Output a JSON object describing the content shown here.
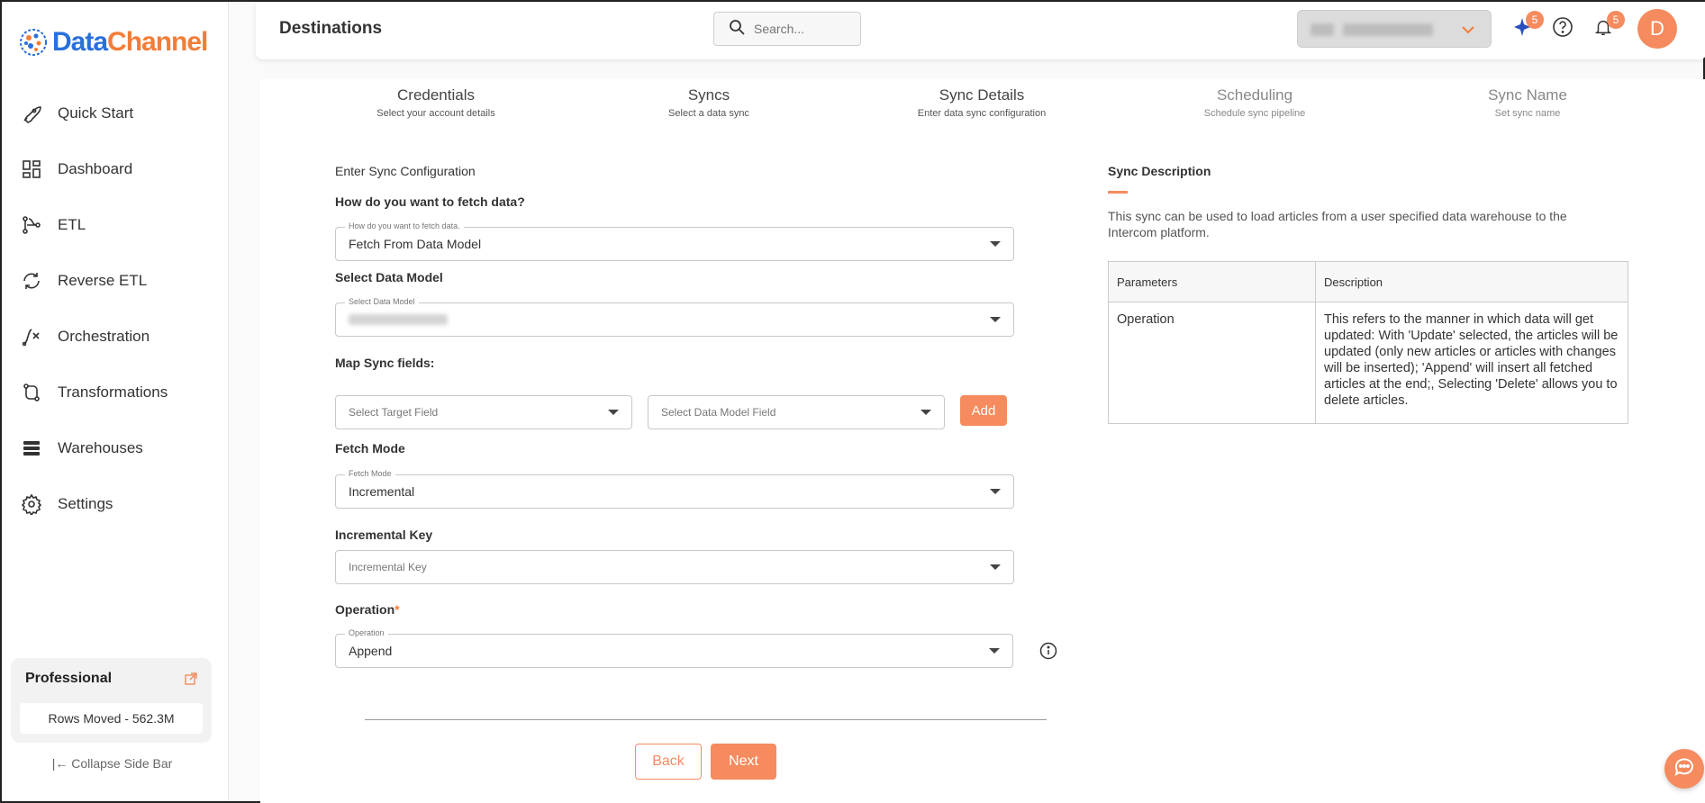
{
  "brand": {
    "name_part1": "Data",
    "name_part2": "Channel",
    "accent": "#f58b5e",
    "blue": "#2a6fdb"
  },
  "sidebar": {
    "items": [
      {
        "label": "Quick Start",
        "icon": "rocket-icon"
      },
      {
        "label": "Dashboard",
        "icon": "dashboard-icon"
      },
      {
        "label": "ETL",
        "icon": "etl-icon"
      },
      {
        "label": "Reverse ETL",
        "icon": "reverse-etl-icon"
      },
      {
        "label": "Orchestration",
        "icon": "orchestration-icon"
      },
      {
        "label": "Transformations",
        "icon": "transformations-icon"
      },
      {
        "label": "Warehouses",
        "icon": "warehouses-icon"
      },
      {
        "label": "Settings",
        "icon": "gear-icon"
      }
    ],
    "plan": {
      "title": "Professional",
      "rows_moved": "Rows Moved - 562.3M"
    },
    "collapse_label": "Collapse Side Bar"
  },
  "header": {
    "title": "Destinations",
    "search_placeholder": "Search...",
    "ai_badge": "5",
    "notif_badge": "5",
    "avatar_initial": "D"
  },
  "stepper": [
    {
      "title": "Credentials",
      "sub": "Select your account details"
    },
    {
      "title": "Syncs",
      "sub": "Select a data sync"
    },
    {
      "title": "Sync Details",
      "sub": "Enter data sync configuration"
    },
    {
      "title": "Scheduling",
      "sub": "Schedule sync pipeline"
    },
    {
      "title": "Sync Name",
      "sub": "Set sync name"
    }
  ],
  "form": {
    "heading": "Enter Sync Configuration",
    "fetch": {
      "label": "How do you want to fetch data?",
      "float": "How do you want to fetch data.",
      "value": "Fetch From Data Model"
    },
    "model": {
      "label": "Select Data Model",
      "float": "Select Data Model"
    },
    "map": {
      "label": "Map Sync fields:",
      "target_ph": "Select Target Field",
      "model_ph": "Select Data Model Field",
      "add": "Add"
    },
    "mode": {
      "label": "Fetch Mode",
      "float": "Fetch Mode",
      "value": "Incremental"
    },
    "inc_key": {
      "label": "Incremental Key",
      "placeholder": "Incremental Key"
    },
    "operation": {
      "label": "Operation",
      "required_mark": "*",
      "float": "Operation",
      "value": "Append"
    },
    "back": "Back",
    "next": "Next"
  },
  "description": {
    "title": "Sync Description",
    "text": "This sync can be used to load articles from a user specified data warehouse to the Intercom platform.",
    "table": {
      "headers": [
        "Parameters",
        "Description"
      ],
      "rows": [
        [
          "Operation",
          "This refers to the manner in which data will get updated: With 'Update' selected, the articles will be updated (only new articles or articles with changes will be inserted); 'Append' will insert all fetched articles at the end;, Selecting 'Delete' allows you to delete articles."
        ]
      ]
    }
  }
}
